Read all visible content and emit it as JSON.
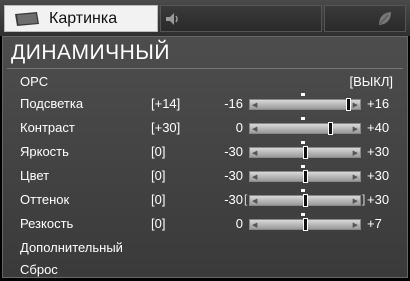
{
  "tabs": {
    "active_label": "Картинка"
  },
  "icons": {
    "tab1": "tv-icon",
    "tab2": "speaker-icon",
    "tab3": "leaf-icon"
  },
  "menu": {
    "title": "ДИНАМИЧНЫЙ",
    "opc": {
      "label": "OPC",
      "value": "[ВЫКЛ]"
    },
    "rows": [
      {
        "label": "Подсветка",
        "value": "[+14]",
        "min": "-16",
        "max": "+16",
        "level": 0.94
      },
      {
        "label": "Контраст",
        "value": "[+30]",
        "min": "0",
        "max": "+40",
        "level": 0.75
      },
      {
        "label": "Яркость",
        "value": "[0]",
        "min": "-30",
        "max": "+30",
        "level": 0.5
      },
      {
        "label": "Цвет",
        "value": "[0]",
        "min": "-30",
        "max": "+30",
        "level": 0.5
      },
      {
        "label": "Оттенок",
        "value": "[0]",
        "min": "-30",
        "max": "+30",
        "level": 0.5,
        "brackets": true
      },
      {
        "label": "Резкость",
        "value": "[0]",
        "min": "0",
        "max": "+7",
        "level": 0.5
      }
    ],
    "advanced": "Дополнительный",
    "reset": "Сброс"
  }
}
